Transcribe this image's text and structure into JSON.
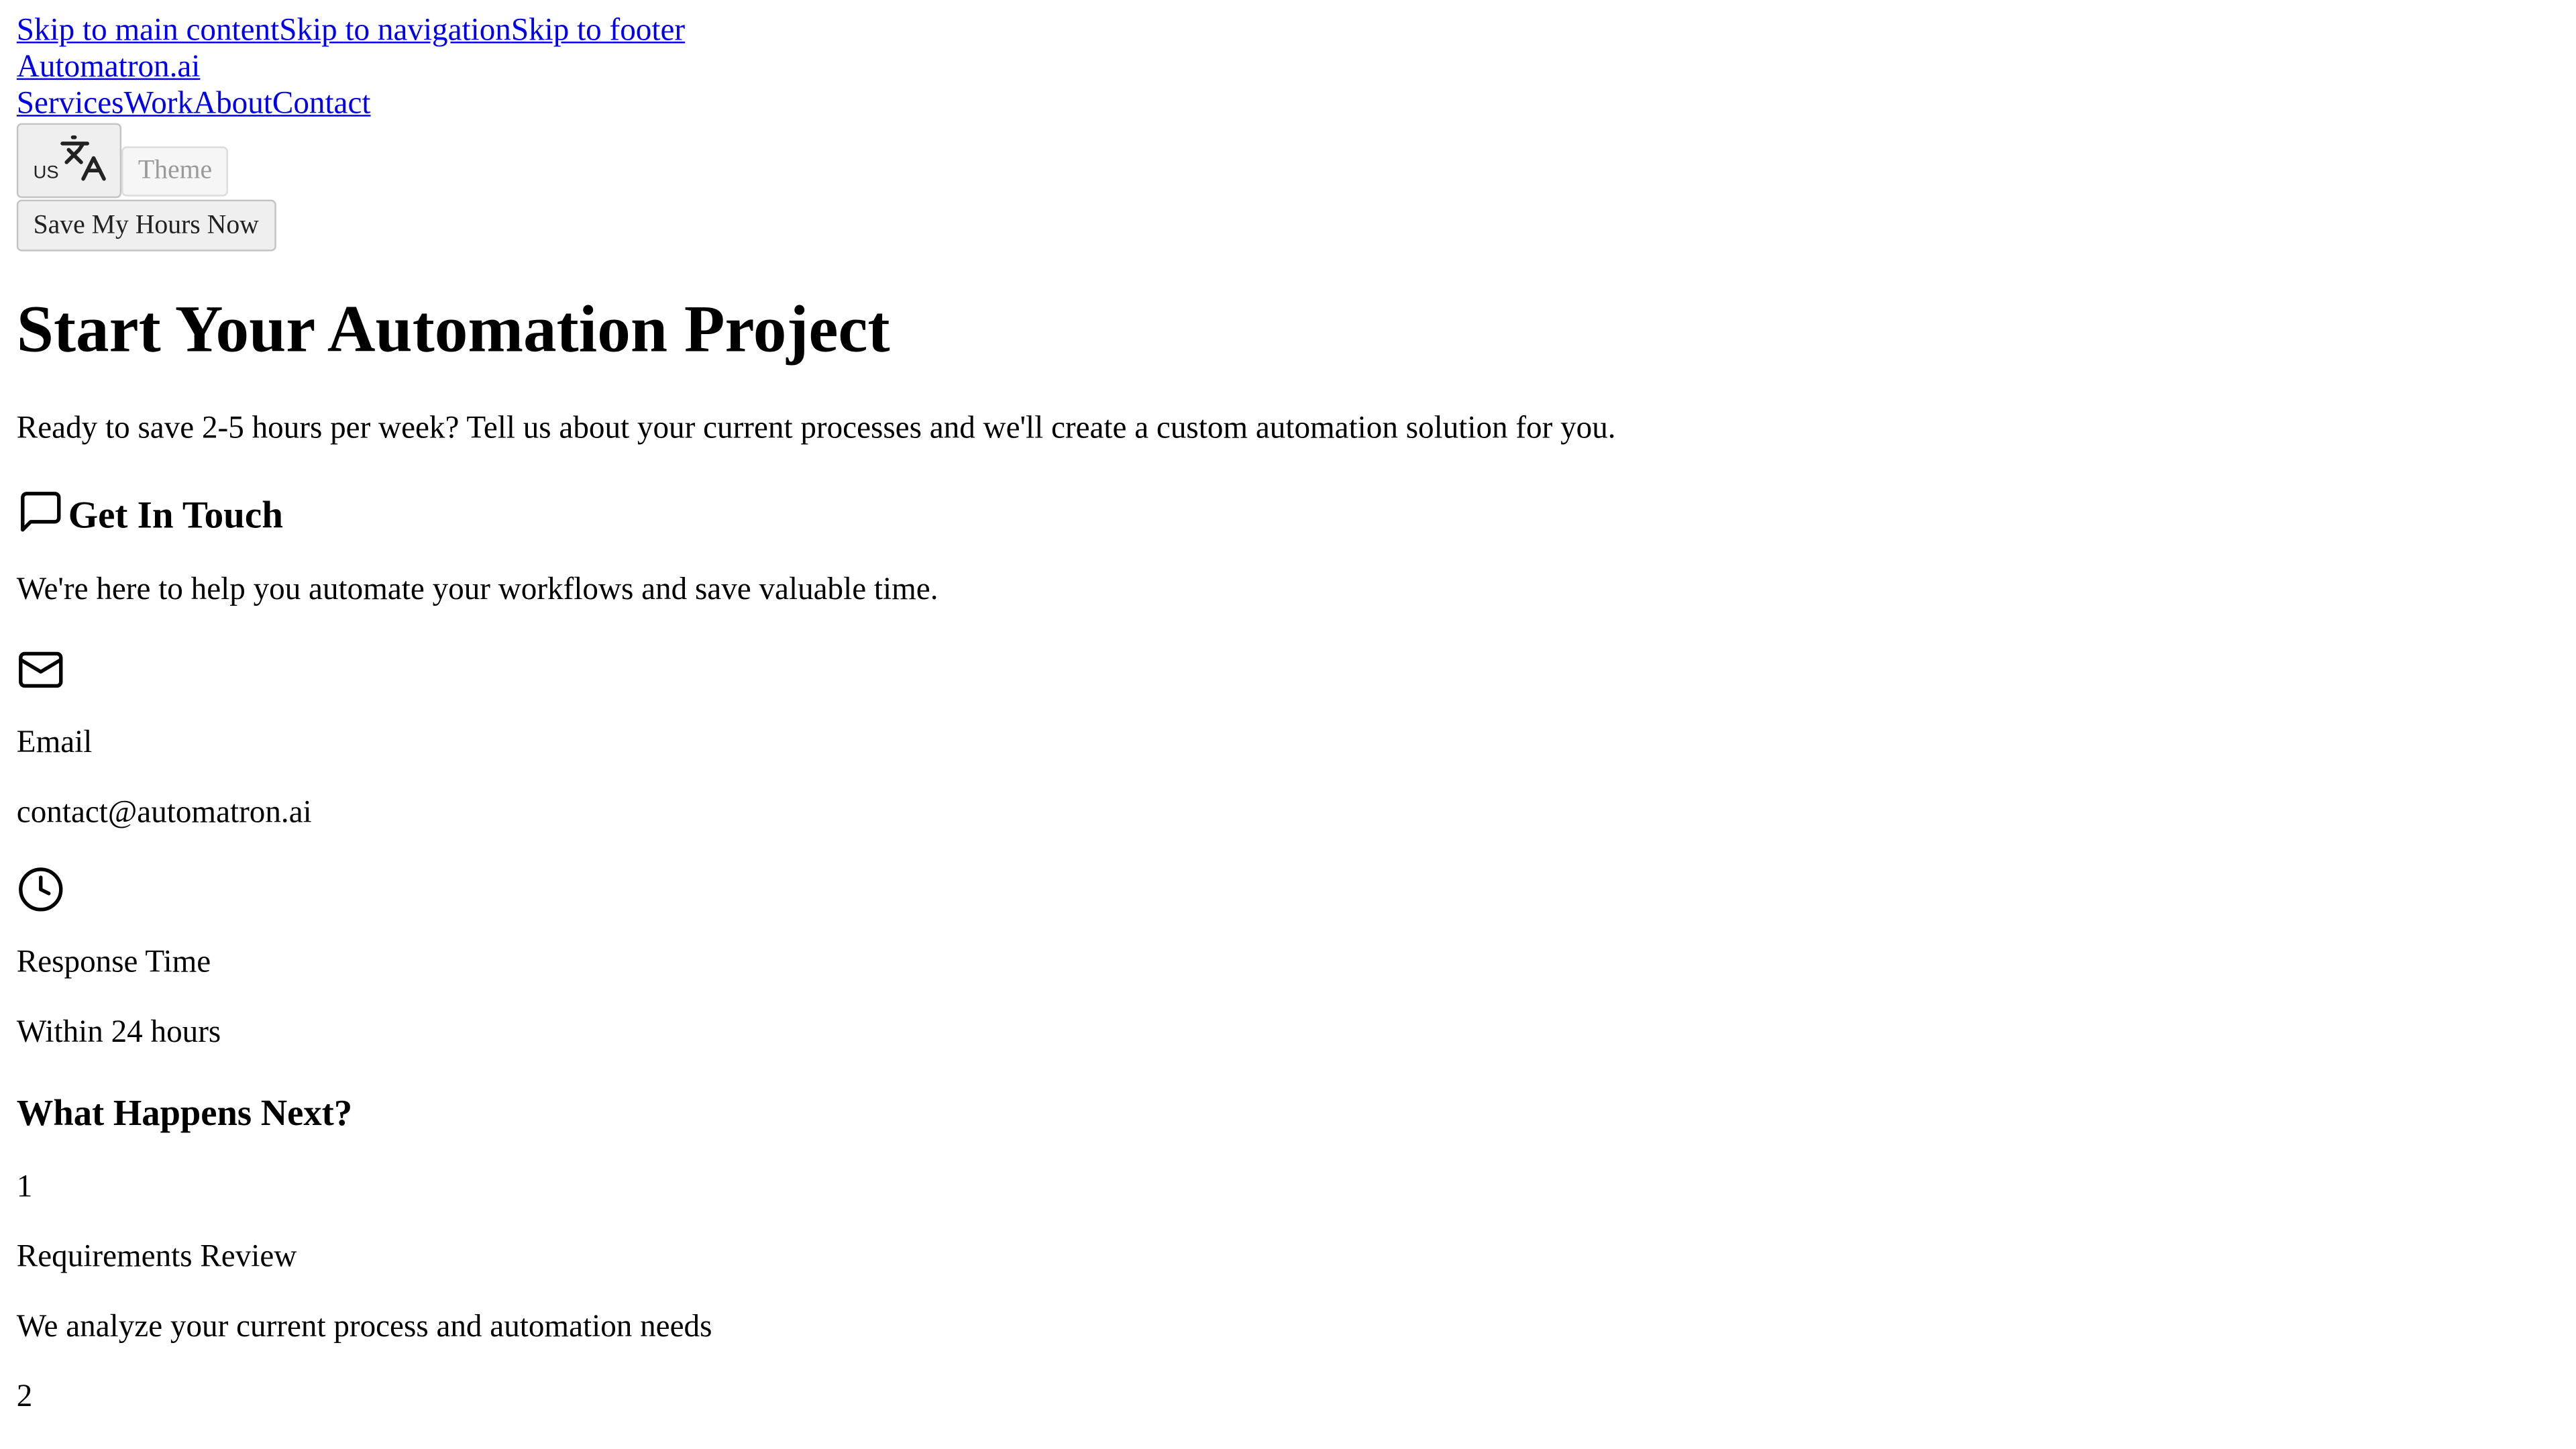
{
  "skip_links": [
    "Skip to main content",
    "Skip to navigation",
    "Skip to footer"
  ],
  "brand": "Automatron.ai",
  "nav": [
    "Services",
    "Work",
    "About",
    "Contact"
  ],
  "language_button": {
    "label": "US",
    "icon": "translate-icon"
  },
  "theme_button": "Theme",
  "cta_button": "Save My Hours Now",
  "hero": {
    "title": "Start Your Automation Project",
    "subtitle": "Ready to save 2-5 hours per week? Tell us about your current processes and we'll create a custom automation solution for you."
  },
  "contact": {
    "icon": "message-square-icon",
    "title": "Get In Touch",
    "intro": "We're here to help you automate your workflows and save valuable time.",
    "email": {
      "icon": "mail-icon",
      "label": "Email",
      "value": "contact@automatron.ai"
    },
    "response": {
      "icon": "clock-icon",
      "label": "Response Time",
      "value": "Within 24 hours"
    }
  },
  "next_steps": {
    "title": "What Happens Next?",
    "steps": [
      {
        "number": "1",
        "title": "Requirements Review",
        "description": "We analyze your current process and automation needs"
      },
      {
        "number": "2"
      }
    ]
  }
}
